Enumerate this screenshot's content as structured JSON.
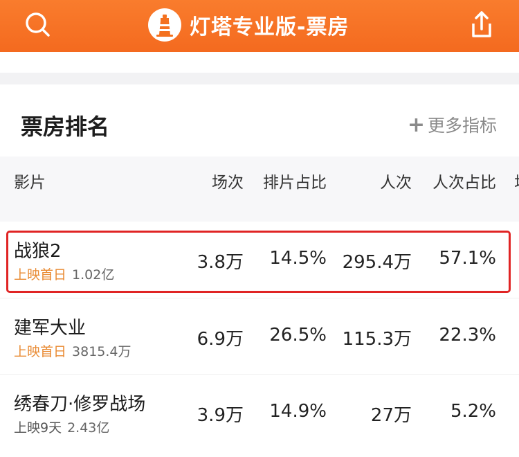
{
  "header": {
    "app_title": "灯塔专业版-票房",
    "icons": {
      "search": "search-icon",
      "logo": "lighthouse-logo-icon",
      "share": "share-icon"
    },
    "accent_color": "#f4711f"
  },
  "section": {
    "title": "票房排名",
    "more_plus": "+",
    "more_label": "更多指标"
  },
  "table": {
    "columns": [
      "影片",
      "场次",
      "排片占比",
      "人次",
      "人次占比",
      "场"
    ],
    "rows": [
      {
        "name": "战狼2",
        "tag": "上映首日",
        "box_office": "1.02亿",
        "screenings": "3.8万",
        "screening_ratio": "14.5%",
        "attendance": "295.4万",
        "attendance_ratio": "57.1%",
        "highlighted": true
      },
      {
        "name": "建军大业",
        "tag": "上映首日",
        "box_office": "3815.4万",
        "screenings": "6.9万",
        "screening_ratio": "26.5%",
        "attendance": "115.3万",
        "attendance_ratio": "22.3%",
        "highlighted": false
      },
      {
        "name": "绣春刀·修罗战场",
        "tag": "上映9天",
        "box_office": "2.43亿",
        "screenings": "3.9万",
        "screening_ratio": "14.9%",
        "attendance": "27万",
        "attendance_ratio": "5.2%",
        "highlighted": false
      }
    ]
  },
  "colors": {
    "highlight_border": "#e02424",
    "tag_orange": "#e98a32"
  }
}
